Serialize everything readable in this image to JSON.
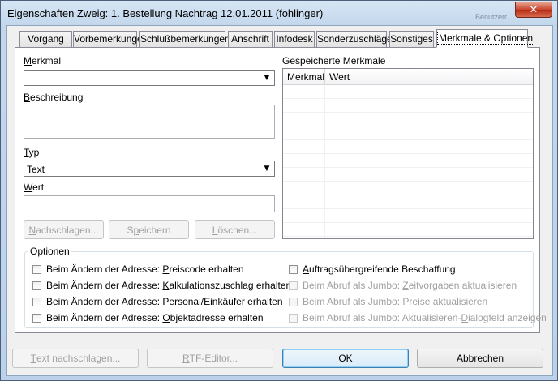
{
  "window": {
    "title": "Eigenschaften Zweig: 1. Bestellung Nachtrag 12.01.2011 (fohlinger)",
    "ghost_text": "Benutzerr...",
    "close_glyph": "✕"
  },
  "tabs": [
    {
      "label": "Vorgang"
    },
    {
      "label": "Vorbemerkungen"
    },
    {
      "label": "Schlußbemerkungen"
    },
    {
      "label": "Anschrift"
    },
    {
      "label": "Infodesk"
    },
    {
      "label": "Sonderzuschläge"
    },
    {
      "label": "Sonstiges"
    },
    {
      "label": "Merkmale & Optionen",
      "active": true
    }
  ],
  "form": {
    "merkmal": {
      "label_ul": "M",
      "label_rest": "erkmal",
      "value": ""
    },
    "beschreibung": {
      "label_ul": "B",
      "label_rest": "eschreibung",
      "value": ""
    },
    "typ": {
      "label_ul": "T",
      "label_rest": "yp",
      "value": "Text"
    },
    "wert": {
      "label_ul": "W",
      "label_rest": "ert",
      "value": ""
    },
    "buttons": {
      "nachschlagen_ul": "N",
      "nachschlagen_rest": "achschlagen...",
      "speichern_pre": "S",
      "speichern_ul": "p",
      "speichern_rest": "eichern",
      "loeschen_ul": "L",
      "loeschen_rest": "öschen..."
    }
  },
  "saved": {
    "title": "Gespeicherte Merkmale",
    "columns": [
      "Merkmal",
      "Wert"
    ]
  },
  "optionen": {
    "title": "Optionen",
    "left": [
      {
        "pre": "Beim Ändern der Adresse: ",
        "ul": "P",
        "rest": "reiscode erhalten",
        "checked": false,
        "disabled": false
      },
      {
        "pre": "Beim Ändern der Adresse: ",
        "ul": "K",
        "rest": "alkulationszuschlag erhalten",
        "checked": false,
        "disabled": false
      },
      {
        "pre": "Beim Ändern der Adresse: Personal/",
        "ul": "E",
        "rest": "inkäufer erhalten",
        "checked": false,
        "disabled": false
      },
      {
        "pre": "Beim Ändern der Adresse: ",
        "ul": "O",
        "rest": "bjektadresse erhalten",
        "checked": false,
        "disabled": false
      }
    ],
    "right": [
      {
        "pre": "",
        "ul": "A",
        "rest": "uftragsübergreifende Beschaffung",
        "checked": false,
        "disabled": false
      },
      {
        "pre": "Beim Abruf als Jumbo: ",
        "ul": "Z",
        "rest": "eitvorgaben aktualisieren",
        "checked": false,
        "disabled": true
      },
      {
        "pre": "Beim Abruf als Jumbo: ",
        "ul": "P",
        "rest": "reise aktualisieren",
        "checked": false,
        "disabled": true
      },
      {
        "pre": "Beim Abruf als Jumbo: Aktualisieren-",
        "ul": "D",
        "rest": "ialogfeld anzeigen",
        "checked": false,
        "disabled": true
      }
    ]
  },
  "footer": {
    "text_nachschlagen_ul": "T",
    "text_nachschlagen_rest": "ext nachschlagen...",
    "rtf_ul": "R",
    "rtf_rest": "TF-Editor...",
    "ok": "OK",
    "abbrechen": "Abbrechen"
  }
}
